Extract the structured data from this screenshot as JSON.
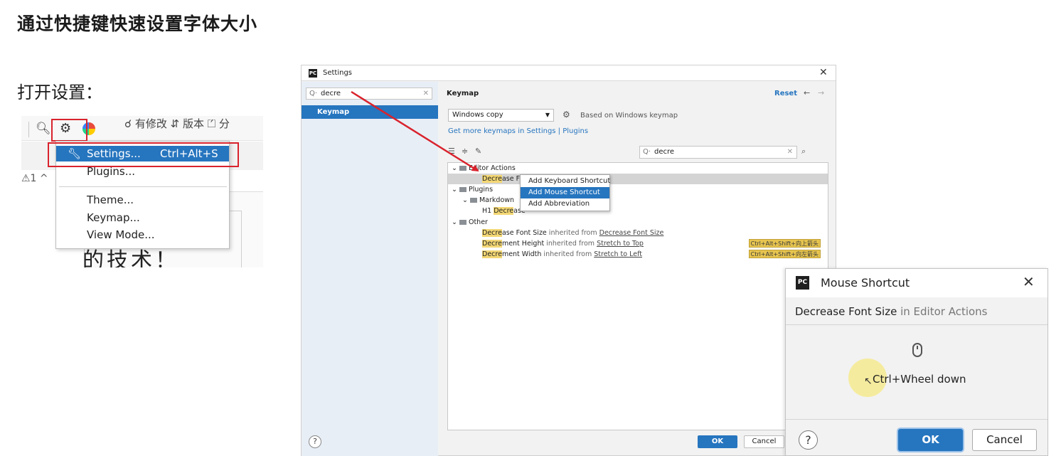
{
  "slide": {
    "title": "通过快捷键快速设置字体大小",
    "subtitle": "打开设置："
  },
  "toolbar_crop": {
    "vcs_text": "☌ 有修改  ⇵ 版本  ⏍ 分",
    "warning_text": "⚠1 ^",
    "editor_text": "的技术！",
    "menu": {
      "items": [
        {
          "label": "Settings...",
          "shortcut": "Ctrl+Alt+S"
        },
        {
          "label": "Plugins..."
        },
        {
          "label": "Theme..."
        },
        {
          "label": "Keymap..."
        },
        {
          "label": "View Mode..."
        }
      ]
    }
  },
  "settings": {
    "title": "Settings",
    "search": "decre",
    "nav_selected": "Keymap",
    "header": "Keymap",
    "reset": "Reset",
    "keymap_combo": "Windows copy",
    "based_on": "Based on Windows keymap",
    "get_more": "Get more keymaps in Settings | Plugins",
    "action_search": "decre",
    "tree": {
      "editor_actions": "Editor Actions",
      "row_decrease_fo": {
        "hl": "Decre",
        "rest": "ase Fo"
      },
      "plugins": "Plugins",
      "markdown": "Markdown",
      "md_row": {
        "prefix": "H1 ",
        "hl": "Decre",
        "rest": "ase"
      },
      "other": "Other",
      "other_rows": [
        {
          "hl": "Decre",
          "rest": "ase Font Size",
          "inh": " inherited from ",
          "link": "Decrease Font Size",
          "shortcut": ""
        },
        {
          "hl": "Decre",
          "rest": "ment Height",
          "inh": " inherited from ",
          "link": "Stretch to Top",
          "shortcut": "Ctrl+Alt+Shift+向上箭头"
        },
        {
          "hl": "Decre",
          "rest": "ment Width",
          "inh": " inherited from ",
          "link": "Stretch to Left",
          "shortcut": "Ctrl+Alt+Shift+向左箭头"
        }
      ]
    },
    "context_menu": [
      "Add Keyboard Shortcut",
      "Add Mouse Shortcut",
      "Add Abbreviation"
    ],
    "ok": "OK",
    "cancel": "Cancel",
    "help": "?"
  },
  "mouse_dialog": {
    "title": "Mouse Shortcut",
    "action": "Decrease Font Size",
    "context": " in Editor Actions",
    "shortcut": "Ctrl+Wheel down",
    "help": "?",
    "ok": "OK",
    "cancel": "Cancel"
  },
  "colors": {
    "accent": "#2675bf",
    "highlight": "#f3d774",
    "annotation_red": "#d9232d"
  }
}
